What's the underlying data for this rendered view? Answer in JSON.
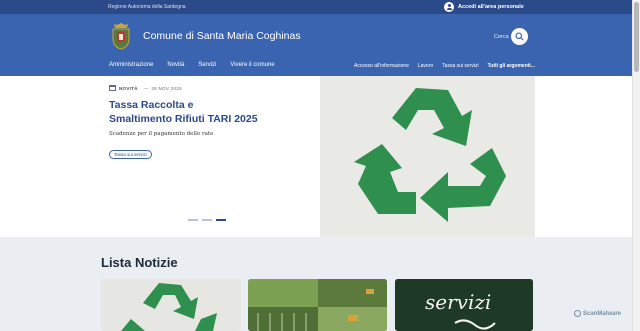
{
  "topbar": {
    "region": "Regione Autonoma della Sardegna",
    "login_label": "Accedi all'area personale"
  },
  "header": {
    "site_title": "Comune di Santa Maria Coghinas",
    "search_label": "Cerca",
    "nav_main": [
      "Amministrazione",
      "Novità",
      "Servizi",
      "Vivere il comune"
    ],
    "nav_secondary": [
      "Accesso all'informazione",
      "Lavoro",
      "Tassa sui servizi",
      "Tutti gli argomenti..."
    ]
  },
  "hero": {
    "category": "NOVITÀ",
    "separator": "—",
    "date": "28 NOV 2025",
    "headline": "Tassa Raccolta e Smaltimento Rifiuti TARI 2025",
    "description": "Scadenze per il pagamento delle rate",
    "tag": "Tassa sui servizi",
    "slides_total": 3,
    "slide_active": 3
  },
  "news": {
    "title": "Lista Notizie",
    "cards": [
      {
        "image": "recycling-symbol"
      },
      {
        "image": "aerial-farmland"
      },
      {
        "image": "chalkboard-servizi"
      }
    ],
    "card3_text": "servizi"
  },
  "watermark": "ScanMalware",
  "colors": {
    "brand_dark": "#2b4a8a",
    "brand": "#3b64b0",
    "recycle_green": "#2f8f4e",
    "section_bg": "#eaedf1"
  }
}
